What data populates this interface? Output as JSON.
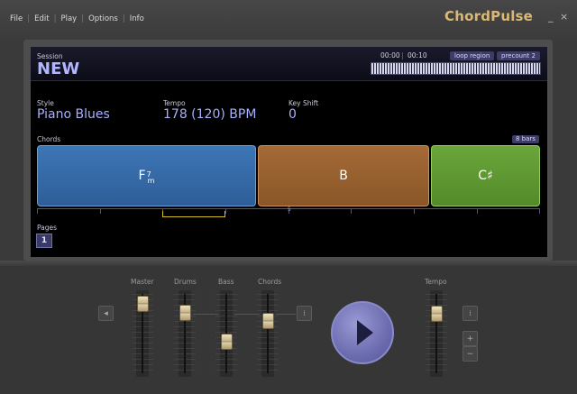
{
  "menu": [
    "File",
    "Edit",
    "Play",
    "Options",
    "Info"
  ],
  "brand": "ChordPulse",
  "window": {
    "minimize": "_",
    "close": "×"
  },
  "session": {
    "label": "Session",
    "name": "NEW"
  },
  "time": {
    "start": "00:00",
    "end": "00:10",
    "loop_region": "loop region",
    "precount": "precount 2"
  },
  "style": {
    "label": "Style",
    "value": "Piano Blues"
  },
  "tempo": {
    "label": "Tempo",
    "value": "178 (120) BPM"
  },
  "key_shift": {
    "label": "Key Shift",
    "value": "0"
  },
  "chords": {
    "label": "Chords",
    "bars": "8 bars",
    "items": [
      {
        "root": "F",
        "ext": "7",
        "quality": "m",
        "color": "#3a72b0"
      },
      {
        "root": "B",
        "color": "#9a6432"
      },
      {
        "root": "C♯",
        "color": "#63a034"
      }
    ],
    "timeline_marker": "5"
  },
  "pages": {
    "label": "Pages",
    "current": "1"
  },
  "mixer": {
    "channels": [
      {
        "name": "Master",
        "level": 0.92
      },
      {
        "name": "Drums",
        "level": 0.8
      },
      {
        "name": "Bass",
        "level": 0.38
      },
      {
        "name": "Chords",
        "level": 0.68
      }
    ],
    "tempo": {
      "name": "Tempo",
      "level": 0.78
    },
    "plus": "+",
    "minus": "−"
  },
  "colors": {
    "accent": "#d9b878",
    "screen_text": "#aab0ff",
    "play": "#7a7ac0"
  }
}
